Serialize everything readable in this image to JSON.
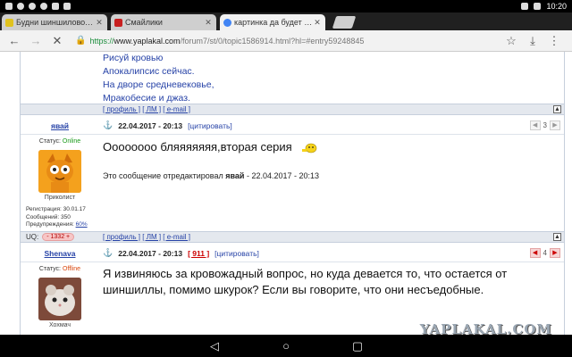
{
  "statusbar": {
    "time": "10:20"
  },
  "tabs": [
    {
      "title": "Будни шиншиловода. Ча",
      "favicon_color": "#e0c21e",
      "close": "✕"
    },
    {
      "title": "Смайлики",
      "favicon_color": "#c82020",
      "close": "✕"
    },
    {
      "title": "картинка да будет срач - Г",
      "favicon_color": "#4285f4",
      "close": "✕"
    }
  ],
  "omnibox": {
    "url_scheme": "https://",
    "url_host": "www.yaplakal.com",
    "url_path": "/forum7/st/0/topic1586914.html?hl=#entry59248845"
  },
  "quote": {
    "lines": [
      "Рисуй кровью",
      "Апокалипсис сейчас.",
      "На дворе средневековье,",
      "Мракобесие и джаз."
    ]
  },
  "post_links": [
    "[ профиль ]",
    "[ ЛМ ]",
    "[ e-mail ]"
  ],
  "post1": {
    "author": "явай",
    "date": "22.04.2017 - 20:13",
    "cite": "[цитировать]",
    "rating": "3",
    "status_label": "Статус:",
    "status_value": "Online",
    "rank": "Приколист",
    "reg": "Регистрация: 30.01.17",
    "msgs": "Сообщений: 350",
    "warn_label": "Предупреждения:",
    "warn_value": "60%",
    "text": "Оооооооо бляяяяяяя,вторая серия",
    "edit_prefix": "Это сообщение отредактировал",
    "edit_user": "явай",
    "edit_suffix": "- 22.04.2017 - 20:13",
    "uq_label": "UQ:",
    "uq_value": "- 1332 +"
  },
  "post2": {
    "author": "Shenava",
    "date": "22.04.2017 - 20:13",
    "rate_link": "[ 911 ]",
    "cite": "[цитировать]",
    "rating": "4",
    "status_label": "Статус:",
    "status_value": "Offline",
    "rank": "Хохмач",
    "text_line1": "Я извиняюсь за кровожадный вопрос, но куда девается то, что остается от",
    "text_line2": "шиншиллы, помимо шкурок? Если вы говорите, что они несъедобные."
  },
  "watermark": "YAPLAKAL.COM"
}
